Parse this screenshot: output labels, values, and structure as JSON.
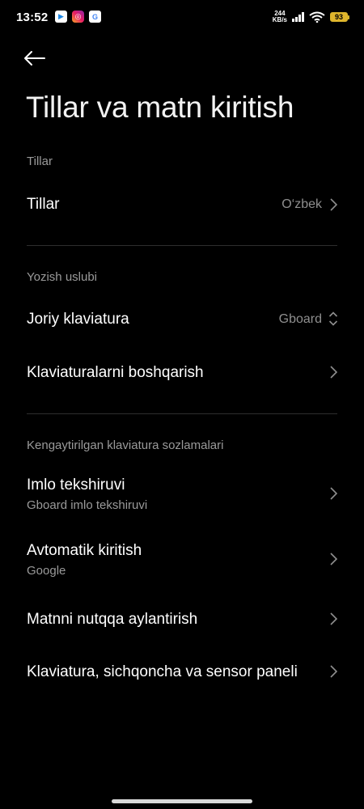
{
  "status_bar": {
    "time": "13:52",
    "net_speed_value": "244",
    "net_speed_unit": "KB/s",
    "battery": "93",
    "notification_icons": [
      "play-store-icon",
      "instagram-icon",
      "google-icon"
    ]
  },
  "header": {
    "title": "Tillar va matn kiritish"
  },
  "sections": {
    "languages": {
      "label": "Tillar",
      "item": {
        "title": "Tillar",
        "value": "O‘zbek"
      }
    },
    "input_method": {
      "label": "Yozish uslubi",
      "current_keyboard": {
        "title": "Joriy klaviatura",
        "value": "Gboard"
      },
      "manage_keyboards": {
        "title": "Klaviaturalarni boshqarish"
      }
    },
    "advanced": {
      "label": "Kengaytirilgan klaviatura sozlamalari",
      "spell_check": {
        "title": "Imlo tekshiruvi",
        "subtitle": "Gboard imlo tekshiruvi"
      },
      "autofill": {
        "title": "Avtomatik kiritish",
        "subtitle": "Google"
      },
      "tts": {
        "title": "Matnni nutqqa aylantirish"
      },
      "keyboard_mouse": {
        "title": "Klaviatura, sichqoncha va sensor paneli"
      }
    }
  },
  "colors": {
    "background": "#000000",
    "text_primary": "#ffffff",
    "text_secondary": "#9a9a9a",
    "divider": "#2e2e2e",
    "battery": "#e0b52c"
  }
}
